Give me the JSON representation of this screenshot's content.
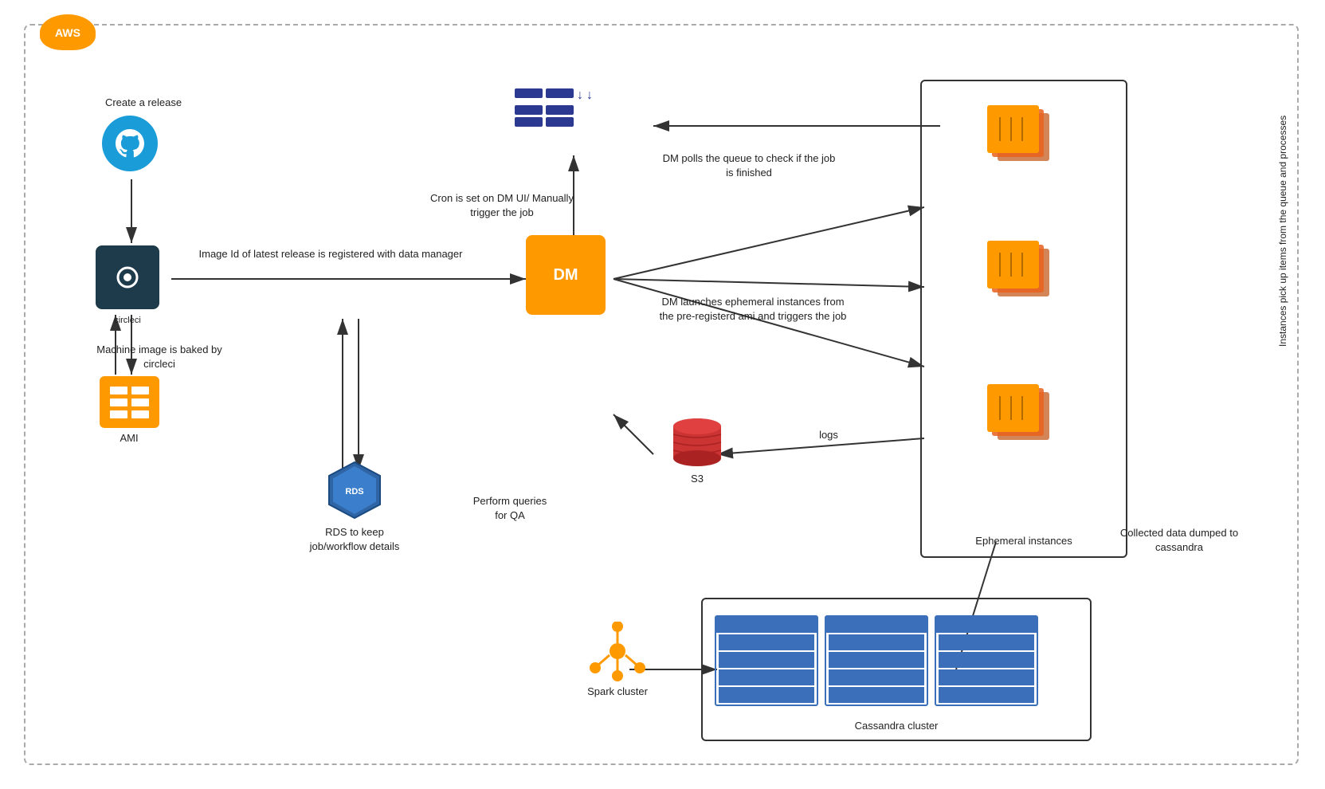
{
  "aws": {
    "logo": "AWS"
  },
  "labels": {
    "create_release": "Create a release",
    "image_id": "Image Id of latest release is registered with data\nmanager",
    "machine_image": "Machine image is baked\nby circleci",
    "ami": "AMI",
    "circleci": "circleci",
    "dm": "DM",
    "cron": "Cron is set on DM UI/\nManually trigger the job",
    "dm_polls": "DM polls the queue to check if\nthe job is finished",
    "dm_launches": "DM launches ephemeral\ninstances from the pre-registerd\nami and triggers the job",
    "rds": "RDS to\nkeep\njob/workflow\ndetails",
    "s3": "S3",
    "logs": "logs",
    "perform_queries": "Perform\nqueries\nfor QA",
    "spark_cluster": "Spark cluster",
    "cassandra_cluster": "Cassandra cluster",
    "ephemeral_instances": "Ephemeral instances",
    "instances_pick": "Instances pick up items from the\nqueue and processes",
    "collected_data": "Collected\ndata dumped\nto cassandra"
  }
}
